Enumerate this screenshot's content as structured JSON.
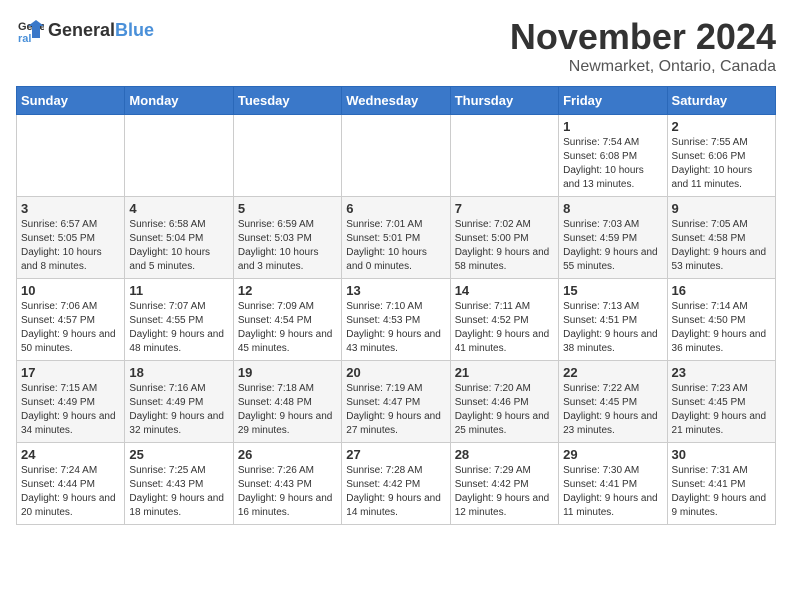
{
  "logo": {
    "text_general": "General",
    "text_blue": "Blue"
  },
  "title": "November 2024",
  "location": "Newmarket, Ontario, Canada",
  "days_of_week": [
    "Sunday",
    "Monday",
    "Tuesday",
    "Wednesday",
    "Thursday",
    "Friday",
    "Saturday"
  ],
  "weeks": [
    [
      {
        "day": "",
        "info": ""
      },
      {
        "day": "",
        "info": ""
      },
      {
        "day": "",
        "info": ""
      },
      {
        "day": "",
        "info": ""
      },
      {
        "day": "",
        "info": ""
      },
      {
        "day": "1",
        "info": "Sunrise: 7:54 AM\nSunset: 6:08 PM\nDaylight: 10 hours and 13 minutes."
      },
      {
        "day": "2",
        "info": "Sunrise: 7:55 AM\nSunset: 6:06 PM\nDaylight: 10 hours and 11 minutes."
      }
    ],
    [
      {
        "day": "3",
        "info": "Sunrise: 6:57 AM\nSunset: 5:05 PM\nDaylight: 10 hours and 8 minutes."
      },
      {
        "day": "4",
        "info": "Sunrise: 6:58 AM\nSunset: 5:04 PM\nDaylight: 10 hours and 5 minutes."
      },
      {
        "day": "5",
        "info": "Sunrise: 6:59 AM\nSunset: 5:03 PM\nDaylight: 10 hours and 3 minutes."
      },
      {
        "day": "6",
        "info": "Sunrise: 7:01 AM\nSunset: 5:01 PM\nDaylight: 10 hours and 0 minutes."
      },
      {
        "day": "7",
        "info": "Sunrise: 7:02 AM\nSunset: 5:00 PM\nDaylight: 9 hours and 58 minutes."
      },
      {
        "day": "8",
        "info": "Sunrise: 7:03 AM\nSunset: 4:59 PM\nDaylight: 9 hours and 55 minutes."
      },
      {
        "day": "9",
        "info": "Sunrise: 7:05 AM\nSunset: 4:58 PM\nDaylight: 9 hours and 53 minutes."
      }
    ],
    [
      {
        "day": "10",
        "info": "Sunrise: 7:06 AM\nSunset: 4:57 PM\nDaylight: 9 hours and 50 minutes."
      },
      {
        "day": "11",
        "info": "Sunrise: 7:07 AM\nSunset: 4:55 PM\nDaylight: 9 hours and 48 minutes."
      },
      {
        "day": "12",
        "info": "Sunrise: 7:09 AM\nSunset: 4:54 PM\nDaylight: 9 hours and 45 minutes."
      },
      {
        "day": "13",
        "info": "Sunrise: 7:10 AM\nSunset: 4:53 PM\nDaylight: 9 hours and 43 minutes."
      },
      {
        "day": "14",
        "info": "Sunrise: 7:11 AM\nSunset: 4:52 PM\nDaylight: 9 hours and 41 minutes."
      },
      {
        "day": "15",
        "info": "Sunrise: 7:13 AM\nSunset: 4:51 PM\nDaylight: 9 hours and 38 minutes."
      },
      {
        "day": "16",
        "info": "Sunrise: 7:14 AM\nSunset: 4:50 PM\nDaylight: 9 hours and 36 minutes."
      }
    ],
    [
      {
        "day": "17",
        "info": "Sunrise: 7:15 AM\nSunset: 4:49 PM\nDaylight: 9 hours and 34 minutes."
      },
      {
        "day": "18",
        "info": "Sunrise: 7:16 AM\nSunset: 4:49 PM\nDaylight: 9 hours and 32 minutes."
      },
      {
        "day": "19",
        "info": "Sunrise: 7:18 AM\nSunset: 4:48 PM\nDaylight: 9 hours and 29 minutes."
      },
      {
        "day": "20",
        "info": "Sunrise: 7:19 AM\nSunset: 4:47 PM\nDaylight: 9 hours and 27 minutes."
      },
      {
        "day": "21",
        "info": "Sunrise: 7:20 AM\nSunset: 4:46 PM\nDaylight: 9 hours and 25 minutes."
      },
      {
        "day": "22",
        "info": "Sunrise: 7:22 AM\nSunset: 4:45 PM\nDaylight: 9 hours and 23 minutes."
      },
      {
        "day": "23",
        "info": "Sunrise: 7:23 AM\nSunset: 4:45 PM\nDaylight: 9 hours and 21 minutes."
      }
    ],
    [
      {
        "day": "24",
        "info": "Sunrise: 7:24 AM\nSunset: 4:44 PM\nDaylight: 9 hours and 20 minutes."
      },
      {
        "day": "25",
        "info": "Sunrise: 7:25 AM\nSunset: 4:43 PM\nDaylight: 9 hours and 18 minutes."
      },
      {
        "day": "26",
        "info": "Sunrise: 7:26 AM\nSunset: 4:43 PM\nDaylight: 9 hours and 16 minutes."
      },
      {
        "day": "27",
        "info": "Sunrise: 7:28 AM\nSunset: 4:42 PM\nDaylight: 9 hours and 14 minutes."
      },
      {
        "day": "28",
        "info": "Sunrise: 7:29 AM\nSunset: 4:42 PM\nDaylight: 9 hours and 12 minutes."
      },
      {
        "day": "29",
        "info": "Sunrise: 7:30 AM\nSunset: 4:41 PM\nDaylight: 9 hours and 11 minutes."
      },
      {
        "day": "30",
        "info": "Sunrise: 7:31 AM\nSunset: 4:41 PM\nDaylight: 9 hours and 9 minutes."
      }
    ]
  ]
}
